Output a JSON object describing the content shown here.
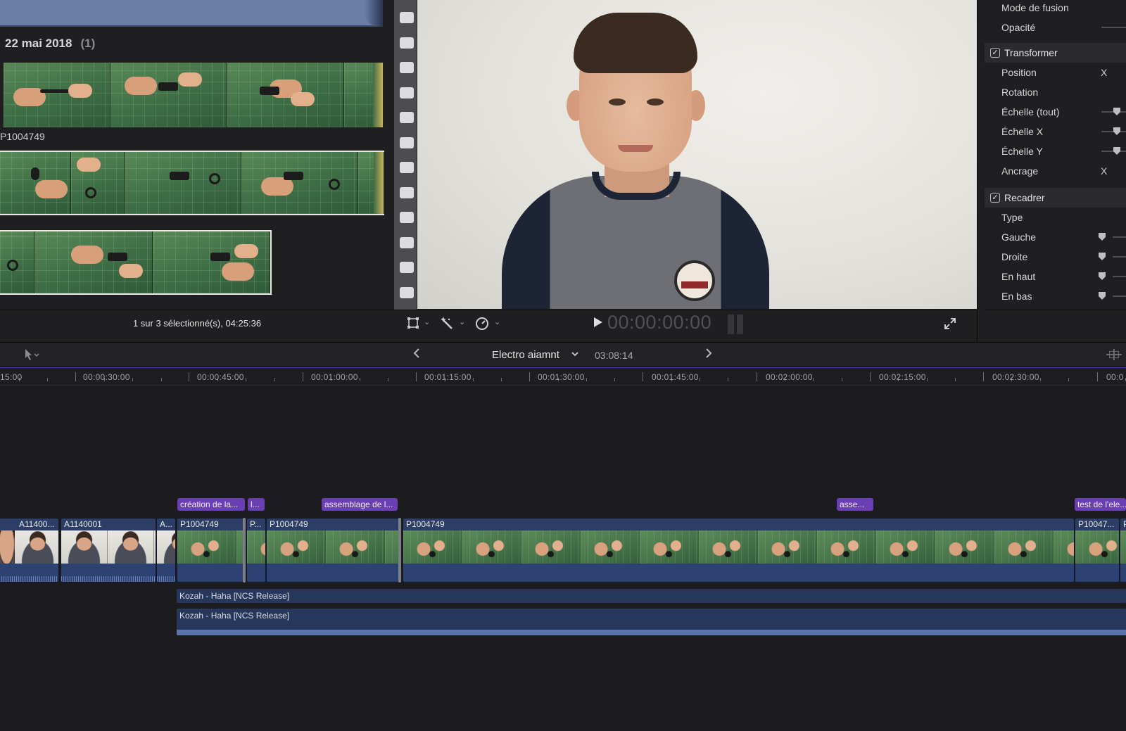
{
  "browser": {
    "date_title": "22 mai 2018",
    "date_count": "(1)",
    "clip_name": "P1004749",
    "status": "1 sur 3 sélectionné(s), 04:25:36"
  },
  "viewer": {
    "timecode": "00:00:00:00",
    "icons": [
      "crop-icon",
      "magic-wand-icon",
      "speed-icon",
      "play-icon",
      "fullscreen-icon"
    ]
  },
  "inspector": {
    "rows_top": [
      {
        "label": "Mode de fusion"
      },
      {
        "label": "Opacité"
      }
    ],
    "transform": {
      "title": "Transformer",
      "checked": true,
      "rows": [
        {
          "label": "Position",
          "value": "X"
        },
        {
          "label": "Rotation",
          "value": ""
        },
        {
          "label": "Échelle (tout)",
          "value": ""
        },
        {
          "label": "Échelle X",
          "value": ""
        },
        {
          "label": "Échelle Y",
          "value": ""
        },
        {
          "label": "Ancrage",
          "value": "X"
        }
      ]
    },
    "crop": {
      "title": "Recadrer",
      "checked": true,
      "rows": [
        {
          "label": "Type"
        },
        {
          "label": "Gauche"
        },
        {
          "label": "Droite"
        },
        {
          "label": "En haut"
        },
        {
          "label": "En bas"
        }
      ]
    }
  },
  "timeline": {
    "project_name": "Electro aiamnt",
    "duration": "03:08:14",
    "ruler_labels": [
      "15:00",
      "00:00:30:00",
      "00:00:45:00",
      "00:01:00:00",
      "00:01:15:00",
      "00:01:30:00",
      "00:01:45:00",
      "00:02:00:00",
      "00:02:15:00",
      "00:02:30:00",
      "00:0"
    ],
    "markers": [
      "création de la...",
      "l...",
      "assemblage de l...",
      "asse...",
      "test de l'ele..."
    ],
    "clips": [
      "A11400...",
      "A1140001",
      "A...",
      "P1004749",
      "P...",
      "P1004749",
      "P1004749",
      "P10047...",
      "P"
    ],
    "music": [
      "Kozah - Haha [NCS Release]",
      "Kozah - Haha [NCS Release]"
    ]
  },
  "colors": {
    "marker": "#6a3fb3",
    "clip": "#2c3e66",
    "ruler_line": "#4b3fa1",
    "panel_bg": "#1f1f21"
  }
}
